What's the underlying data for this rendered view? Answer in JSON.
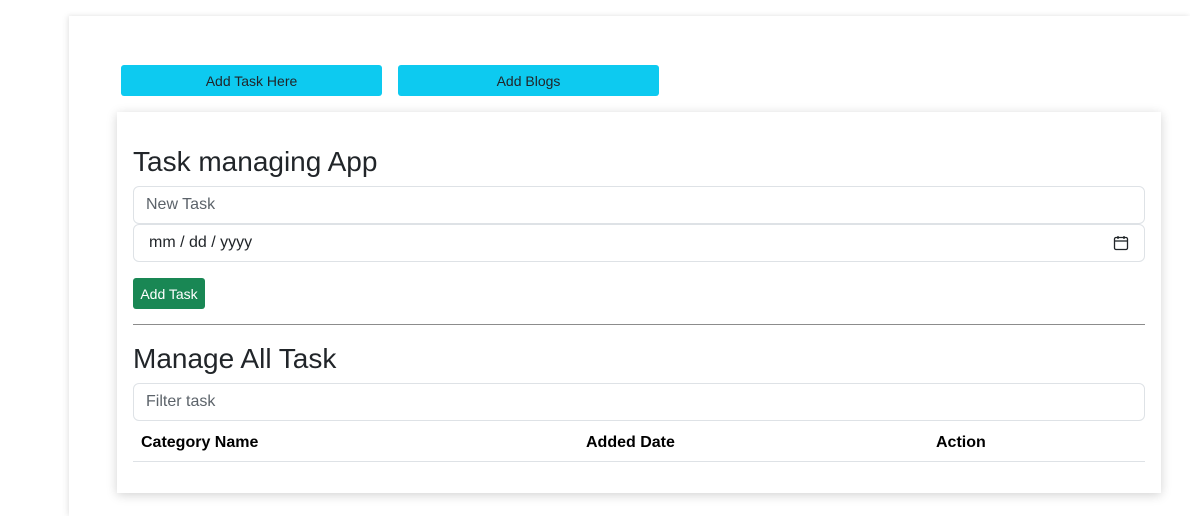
{
  "nav": {
    "add_task_here": "Add Task Here",
    "add_blogs": "Add Blogs"
  },
  "task_form": {
    "title": "Task managing App",
    "task_placeholder": "New Task",
    "date_placeholder": "mm / dd / yyyy",
    "date_icon": "calendar-icon",
    "add_button": "Add Task"
  },
  "manage": {
    "title": "Manage All Task",
    "filter_placeholder": "Filter task",
    "columns": [
      "Category Name",
      "Added Date",
      "Action"
    ]
  },
  "colors": {
    "info_button": "#0dcaf0",
    "success_button": "#198754"
  }
}
